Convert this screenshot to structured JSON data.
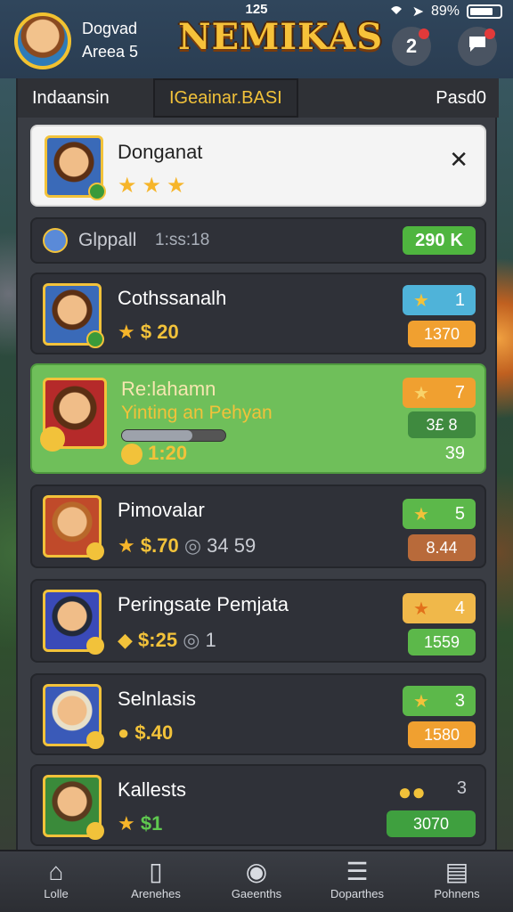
{
  "status_bar": {
    "time": "125",
    "battery": "89%",
    "wifi_icon": "wifi-icon",
    "location_icon": "location-arrow-icon"
  },
  "header": {
    "player_name": "Dogvad",
    "player_area": "Areea 5",
    "logo": "NEMIKAS",
    "notification_count": "2"
  },
  "tabs": [
    {
      "label": "Indaansin",
      "active": false
    },
    {
      "label": "IGeainar.BASI",
      "active": true
    },
    {
      "label": "Pasd0",
      "active": false
    }
  ],
  "featured": {
    "name": "Donganat",
    "stars": "★★★",
    "close_icon": "close-icon"
  },
  "summary": {
    "label": "Glppall",
    "value": "1:ss:18",
    "reward": "290",
    "reward_suffix": "K"
  },
  "items": [
    {
      "name": "Cothssanalh",
      "stars": "★",
      "amount": "$ 20",
      "extra": "",
      "badge_value": "1",
      "bottom_value": "1370",
      "highlighted": false,
      "top_color": "#4fb3d9",
      "bottom_color": "#f0a030"
    },
    {
      "name": "Re:lahamn",
      "subtitle": "Yinting an Pehyan",
      "progress": 0.68,
      "amount": "1:20",
      "badge_value": "7",
      "mid_value": "3£ 8",
      "bottom_value": "39",
      "highlighted": true,
      "top_color": "#f0a030",
      "bottom_color": "#3f8a3f"
    },
    {
      "name": "Pimovalar",
      "stars": "★",
      "amount": "$.70",
      "extra": "34 59",
      "badge_value": "5",
      "bottom_value": "8.44",
      "highlighted": false,
      "top_color": "#5cb84a",
      "bottom_color": "#b86a3a"
    },
    {
      "name": "Peringsate Pemjata",
      "stars": "◆",
      "amount": "$:25",
      "extra": "1",
      "badge_value": "4",
      "bottom_value": "1559",
      "highlighted": false,
      "top_color": "#f0b84a",
      "bottom_color": "#5cb84a"
    },
    {
      "name": "Selnlasis",
      "stars": "●",
      "amount": "$.40",
      "extra": "",
      "badge_value": "3",
      "bottom_value": "1580",
      "highlighted": false,
      "top_color": "#5cb84a",
      "bottom_color": "#f0a030"
    },
    {
      "name": "Kallests",
      "stars": "★",
      "amount": "$1",
      "extra": "",
      "badge_value": "3",
      "bottom_value": "3070",
      "highlighted": false,
      "top_color": "#3a3d44",
      "bottom_color": "#3fa03f"
    }
  ],
  "bottom_nav": [
    {
      "label": "Lolle",
      "icon": "home-icon"
    },
    {
      "label": "Arenehes",
      "icon": "arena-icon"
    },
    {
      "label": "Gaeenths",
      "icon": "target-icon"
    },
    {
      "label": "Doparthes",
      "icon": "list-icon"
    },
    {
      "label": "Pohnens",
      "icon": "profile-card-icon"
    }
  ],
  "colors": {
    "accent_gold": "#f2c23a",
    "highlight_green": "#6fbf5a",
    "panel_dark": "#3a3d44"
  }
}
